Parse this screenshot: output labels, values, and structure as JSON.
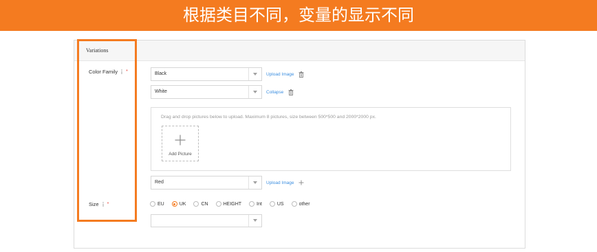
{
  "banner": {
    "title": "根据类目不同，变量的显示不同"
  },
  "colors": {
    "accent": "#F47B20",
    "link": "#3d8fe0",
    "required": "#e8453c",
    "border": "#d9d9d9",
    "header_bg": "#f6f6f6"
  },
  "panel": {
    "title": "Variations"
  },
  "color_family": {
    "label": "Color Family",
    "info_icon": "info-icon",
    "required_mark": "*",
    "rows": [
      {
        "value": "Black",
        "action_label": "Upload Image",
        "action_icon": "trash-icon"
      },
      {
        "value": "White",
        "action_label": "Collapse",
        "action_icon": "trash-icon"
      }
    ],
    "upload": {
      "hint": "Drag and drop pictures below to upload. Maximum 8 pictures, size between 500*500 and 2000*2000 px.",
      "add_label": "Add Picture",
      "add_icon": "plus-icon"
    },
    "extra_row": {
      "value": "Red",
      "action_label": "Upload Image",
      "action_icon": "plus-icon"
    }
  },
  "size": {
    "label": "Size",
    "info_icon": "info-icon",
    "required_mark": "*",
    "options": [
      {
        "label": "EU",
        "selected": false
      },
      {
        "label": "UK",
        "selected": true
      },
      {
        "label": "CN",
        "selected": false
      },
      {
        "label": "HEIGHT",
        "selected": false
      },
      {
        "label": "Int",
        "selected": false
      },
      {
        "label": "US",
        "selected": false
      },
      {
        "label": "other",
        "selected": false
      }
    ],
    "select_value": ""
  }
}
